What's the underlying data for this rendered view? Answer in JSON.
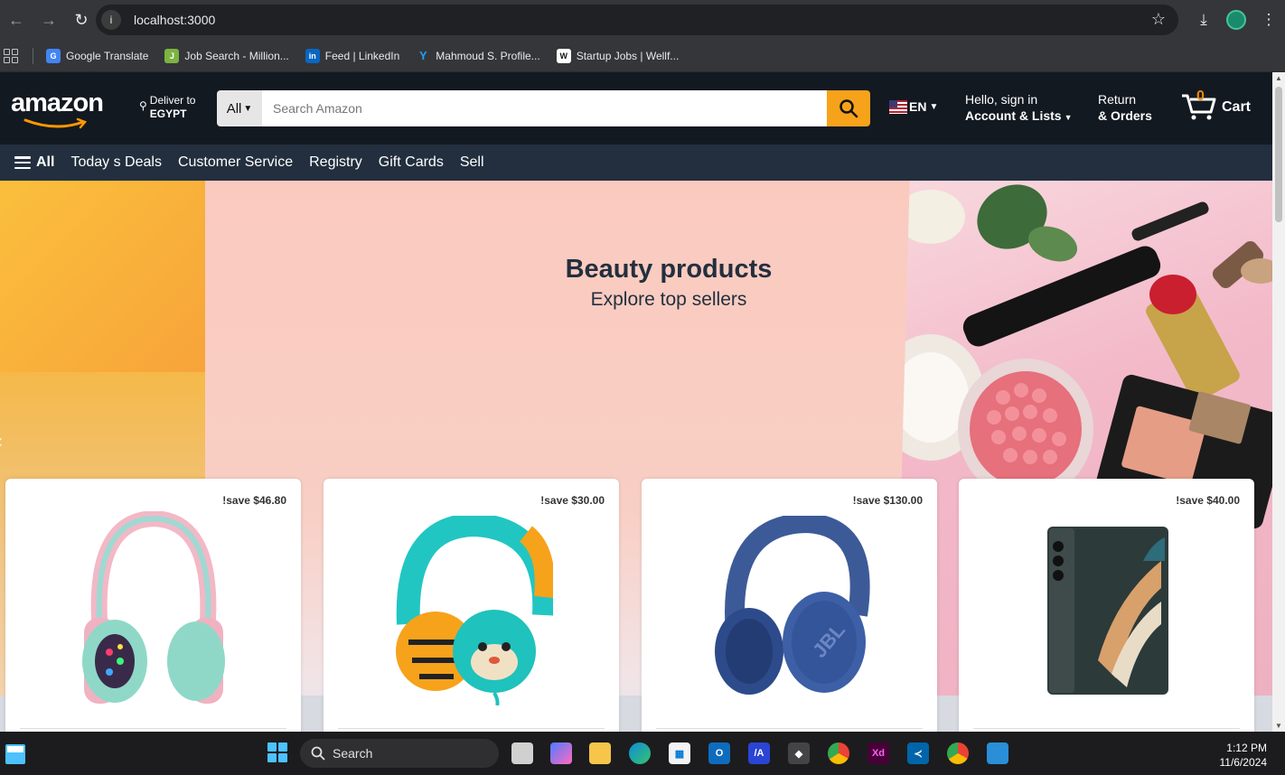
{
  "browser": {
    "url": "localhost:3000",
    "bookmarks": [
      {
        "label": "Google Translate",
        "color": "#4285f4",
        "icon": "G"
      },
      {
        "label": "Job Search - Million...",
        "color": "#8bc34a",
        "icon": "J"
      },
      {
        "label": "Feed | LinkedIn",
        "color": "#0a66c2",
        "icon": "in"
      },
      {
        "label": "Mahmoud S. Profile...",
        "color": "#1da1f2",
        "icon": "Y"
      },
      {
        "label": "Startup Jobs | Wellf...",
        "color": "#ffffff",
        "icon": "W"
      }
    ]
  },
  "header": {
    "logo": "amazon",
    "deliver_line1": "Deliver to",
    "deliver_line2": "EGYPT",
    "search_category": "All",
    "search_placeholder": "Search Amazon",
    "language": "EN",
    "account_line1": "Hello, sign in",
    "account_line2": "Account & Lists",
    "orders_line1": "Return",
    "orders_line2": "& Orders",
    "cart_count": "0",
    "cart_label": "Cart"
  },
  "subnav": {
    "all_label": "All",
    "items": [
      "Today s Deals",
      "Customer Service",
      "Registry",
      "Gift Cards",
      "Sell"
    ]
  },
  "hero": {
    "title": "Beauty products",
    "subtitle": "Explore top sellers"
  },
  "products": [
    {
      "save": "!save $46.80",
      "kind": "pink-headphones"
    },
    {
      "save": "!save $30.00",
      "kind": "kids-headphones"
    },
    {
      "save": "!save $130.00",
      "kind": "blue-headphones"
    },
    {
      "save": "!save $40.00",
      "kind": "foldable-phone"
    }
  ],
  "taskbar": {
    "search_label": "Search",
    "time": "1:12 PM",
    "date": "11/6/2024"
  },
  "colors": {
    "amazon_dark": "#131921",
    "amazon_nav": "#232f3e",
    "search_button": "#f7a21b",
    "cart_count": "#f08804"
  }
}
